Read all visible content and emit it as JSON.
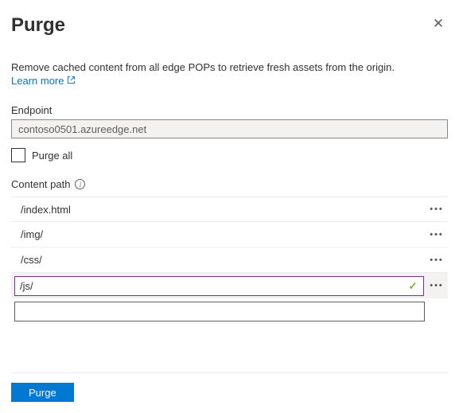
{
  "header": {
    "title": "Purge"
  },
  "description": "Remove cached content from all edge POPs to retrieve fresh assets from the origin.",
  "learn_more_label": "Learn more",
  "endpoint": {
    "label": "Endpoint",
    "value": "contoso0501.azureedge.net"
  },
  "purge_all": {
    "label": "Purge all",
    "checked": false
  },
  "content_path": {
    "label": "Content path",
    "paths": [
      "/index.html",
      "/img/",
      "/css/"
    ],
    "active_value": "/js/",
    "empty_value": ""
  },
  "footer": {
    "purge_button": "Purge"
  }
}
